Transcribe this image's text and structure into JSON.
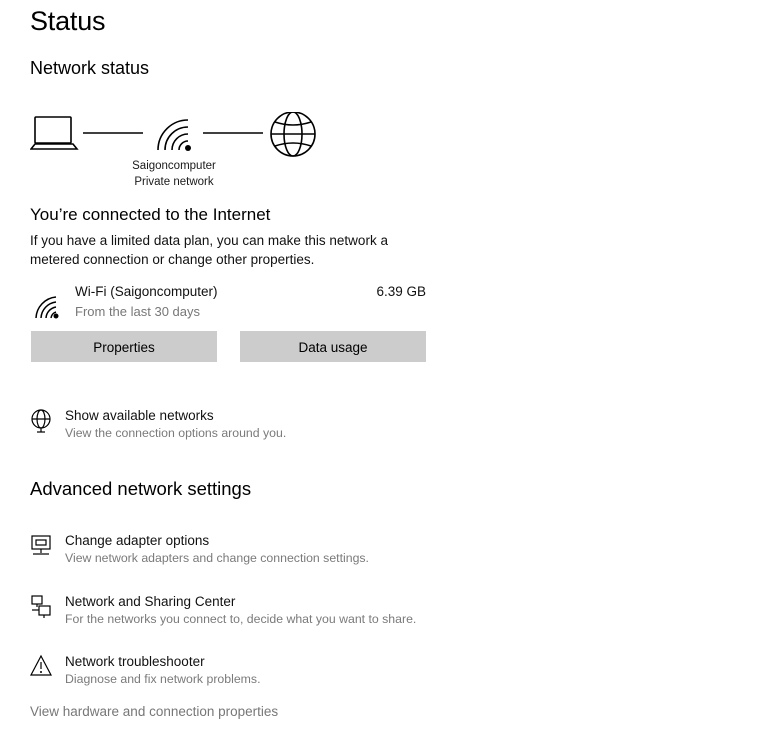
{
  "page_title": "Status",
  "network_status": {
    "heading": "Network status",
    "network_name": "Saigoncomputer",
    "network_type": "Private network"
  },
  "connection": {
    "title": "You’re connected to the Internet",
    "description": "If you have a limited data plan, you can make this network a metered connection or change other properties."
  },
  "wifi": {
    "name": "Wi-Fi (Saigoncomputer)",
    "period": "From the last 30 days",
    "usage": "6.39 GB"
  },
  "buttons": {
    "properties": "Properties",
    "data_usage": "Data usage"
  },
  "show_networks": {
    "label": "Show available networks",
    "sub": "View the connection options around you."
  },
  "advanced": {
    "heading": "Advanced network settings",
    "items": [
      {
        "label": "Change adapter options",
        "sub": "View network adapters and change connection settings.",
        "icon": "adapter-icon"
      },
      {
        "label": "Network and Sharing Center",
        "sub": "For the networks you connect to, decide what you want to share.",
        "icon": "sharing-icon"
      },
      {
        "label": "Network troubleshooter",
        "sub": "Diagnose and fix network problems.",
        "icon": "warning-icon"
      }
    ]
  },
  "bottom_link": "View hardware and connection properties"
}
